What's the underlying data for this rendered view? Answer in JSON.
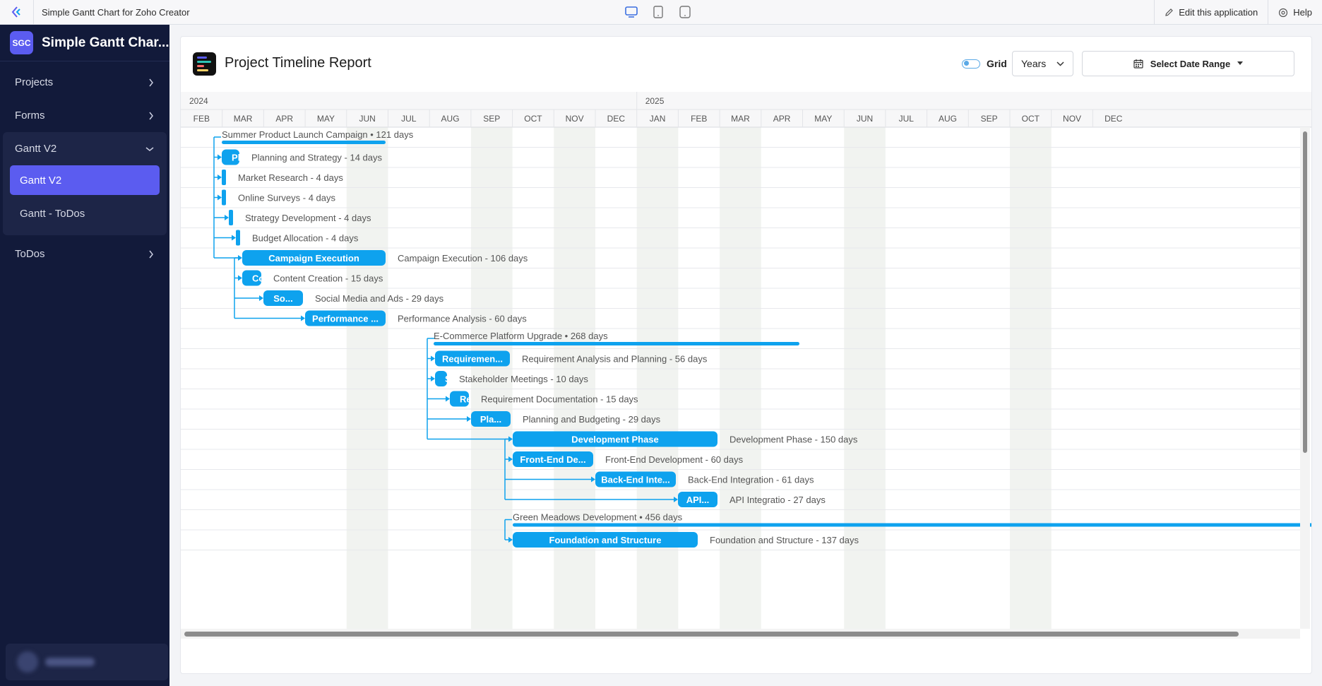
{
  "topbar": {
    "app_title": "Simple Gantt Chart for Zoho Creator",
    "edit_label": "Edit this application",
    "help_label": "Help"
  },
  "sidebar": {
    "avatar": "SGC",
    "app_name": "Simple Gantt Char...",
    "items": [
      {
        "label": "Projects"
      },
      {
        "label": "Forms"
      },
      {
        "label": "Gantt V2",
        "expanded": true,
        "children": [
          {
            "label": "Gantt V2",
            "active": true
          },
          {
            "label": "Gantt - ToDos",
            "active": false
          }
        ]
      },
      {
        "label": "ToDos"
      }
    ]
  },
  "report": {
    "title": "Project Timeline Report",
    "grid_label": "Grid",
    "grid_on": true,
    "scale_select": "Years",
    "date_range_label": "Select Date Range"
  },
  "timeline": {
    "years": [
      "2024",
      "2025"
    ],
    "months": [
      "FEB",
      "MAR",
      "APR",
      "MAY",
      "JUN",
      "JUL",
      "AUG",
      "SEP",
      "OCT",
      "NOV",
      "DEC",
      "JAN",
      "FEB",
      "MAR",
      "APR",
      "MAY",
      "JUN",
      "JUL",
      "AUG",
      "SEP",
      "OCT",
      "NOV",
      "DEC"
    ]
  },
  "tasks": [
    {
      "kind": "project",
      "name": "Summer Product Launch Campaign",
      "duration": "121 days",
      "bar_text": ""
    },
    {
      "kind": "task",
      "name": "Planning and Strategy - 14 days",
      "bar_text": "Pl"
    },
    {
      "kind": "task",
      "name": "Market Research - 4 days",
      "bar_text": ""
    },
    {
      "kind": "task",
      "name": "Online Surveys - 4 days",
      "bar_text": ""
    },
    {
      "kind": "task",
      "name": "Strategy Development - 4 days",
      "bar_text": ""
    },
    {
      "kind": "task",
      "name": "Budget Allocation - 4 days",
      "bar_text": ""
    },
    {
      "kind": "task",
      "name": "Campaign Execution - 106 days",
      "bar_text": "Campaign Execution"
    },
    {
      "kind": "task",
      "name": "Content Creation - 15 days",
      "bar_text": "Co"
    },
    {
      "kind": "task",
      "name": "Social Media and Ads - 29 days",
      "bar_text": "So..."
    },
    {
      "kind": "task",
      "name": "Performance Analysis - 60 days",
      "bar_text": "Performance ..."
    },
    {
      "kind": "project",
      "name": "E-Commerce Platform Upgrade",
      "duration": "268 days",
      "bar_text": ""
    },
    {
      "kind": "task",
      "name": "Requirement Analysis and Planning - 56 days",
      "bar_text": "Requiremen..."
    },
    {
      "kind": "task",
      "name": "Stakeholder Meetings - 10 days",
      "bar_text": "S"
    },
    {
      "kind": "task",
      "name": "Requirement Documentation - 15 days",
      "bar_text": "Re"
    },
    {
      "kind": "task",
      "name": "Planning and Budgeting - 29 days",
      "bar_text": "Pla..."
    },
    {
      "kind": "task",
      "name": "Development Phase - 150 days",
      "bar_text": "Development Phase"
    },
    {
      "kind": "task",
      "name": "Front-End Development - 60 days",
      "bar_text": "Front-End De..."
    },
    {
      "kind": "task",
      "name": "Back-End Integration - 61 days",
      "bar_text": "Back-End Inte..."
    },
    {
      "kind": "task",
      "name": "API Integratio - 27 days",
      "bar_text": "API..."
    },
    {
      "kind": "project",
      "name": "Green Meadows Development",
      "duration": "456 days",
      "bar_text": ""
    },
    {
      "kind": "task",
      "name": "Foundation and Structure - 137 days",
      "bar_text": "Foundation and Structure"
    }
  ],
  "colors": {
    "bar": "#0ea2ee",
    "sidebar_bg": "#121a3a",
    "accent": "#5b5cf0",
    "weekend_col": "#f1f3f0"
  }
}
